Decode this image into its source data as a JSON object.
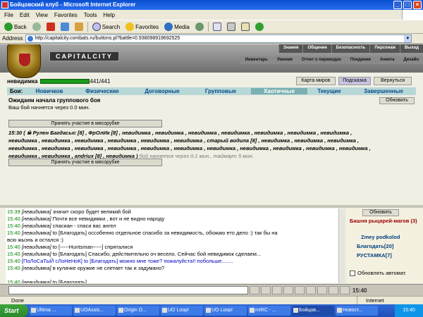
{
  "window": {
    "title": "Бойцовский клуб - Microsoft Internet Explorer",
    "min": "_",
    "max": "□",
    "close": "×"
  },
  "menu": [
    "File",
    "Edit",
    "View",
    "Favorites",
    "Tools",
    "Help"
  ],
  "toolbar": {
    "back": "Back",
    "search": "Search",
    "favorites": "Favorites",
    "media": "Media"
  },
  "address": {
    "label": "Address",
    "url": "http://capitalcity.combats.ru/buttons.pl?battle=0.938098919692525"
  },
  "site": {
    "logo": "CAPITALCITY",
    "nav_top": [
      "Знания",
      "Общение",
      "Безопасность",
      "Персонаж",
      "Выход"
    ],
    "nav_bottom": [
      "Инвентарь",
      "Умения",
      "Отчет о переводах",
      "Поединки",
      "Анкета",
      "Дизайн"
    ]
  },
  "player": {
    "name": "невидимка",
    "hp": "441/441",
    "hp_fraction": 1.0
  },
  "actions": {
    "map": "Карта миров",
    "hint": "Подсказка",
    "back": "Вернуться"
  },
  "tabs": {
    "label": "Бои:",
    "items": [
      "Новичков",
      "Физические",
      "Договорные",
      "Групповые",
      "Хаотичные",
      "Текущие",
      "Завершенные"
    ],
    "active_index": 4
  },
  "battle": {
    "wait_title": "Ожидаем начала группового боя",
    "wait_sub": "Ваш бой начнется через 0.0 мин.",
    "refresh": "Обновить",
    "join": "Принять участие в мясорубке",
    "line1": "15:30 ( ☠ Рулен Багдасыс [8] , ФрОлИк [8] , невидимка , невидимка , невидимка , невидимка , невидимка , невидимка , невидимка ,",
    "line2": "невидимка , невидимка , невидимка , невидимка , невидимка , невидимка , старый водила [8] , невидимка , невидимка , невидимка ,",
    "line3": "невидимка , невидимка , невидимка , невидимка , невидимка , невидимка , невидимка , невидимка , невидимка , невидимка , невидимка ,",
    "line4": "невидимка , невидимка , andriux [8] , невидимка )",
    "line4_tail": "бой начнется через 0.1 мин., таймаут 5 мин."
  },
  "chat": {
    "lines": [
      {
        "time": "15:39",
        "nick": "[невидимка]",
        "text": "значит скоро будет великий бой"
      },
      {
        "time": "15:40",
        "nick": "[невидимка]",
        "text": "Почти все невидимки , вот и не видно народу"
      },
      {
        "time": "15:40",
        "nick": "[невидимка]",
        "text": "спасиан - спаси вас ангел"
      },
      {
        "time": "15:40",
        "nick": "[невидимка]",
        "text": "to [Благодать] оссобенно отдельное спасибо за невидимость, обожаю ето дело :) так бы на"
      },
      {
        "time": "",
        "nick": "",
        "text": "всю жызнь и остался :)"
      },
      {
        "time": "15:40",
        "nick": "[невидимка]",
        "text": "to [-----Huntsman-----] спряталися"
      },
      {
        "time": "15:40",
        "nick": "[невидимка]",
        "text": "to [Благодать] Спасибо, действительно оч весело. Сейчас бой невидимок сделаем..."
      },
      {
        "time": "15:40",
        "nick": "[ПоЛоСаТыЙ сЛоНеНоК]",
        "text": "to [Благодать] можно мне тоже? пожалуйста!! побольше........"
      },
      {
        "time": "15:40",
        "nick": "[невидимка]",
        "text": "в кулачке оружие не слетает так и задумано?"
      },
      {
        "time": "",
        "nick": "",
        "text": ""
      },
      {
        "time": "15:40",
        "nick": "[невидимка]",
        "text": "to [Благодать]"
      }
    ]
  },
  "sidebar": {
    "refresh": "Обновить",
    "group": "Башня рыцарей-магов (3)",
    "members": [
      "Zmey podkolod",
      "Благодать[20]",
      "РУСТАМКА[7]"
    ],
    "auto": "Обновлять автомат."
  },
  "clock": "15:40",
  "status": {
    "left": "Done",
    "zone": "Internet"
  },
  "taskbar": {
    "start": "Start",
    "tasks": [
      "Ultima ...",
      "UOAssis...",
      "Origin O...",
      "UO Loop!",
      "UO Loop!",
      "mIRC - ...",
      "Бойцов...",
      "Новост..."
    ],
    "active_index": 6,
    "tray": "15:40"
  }
}
